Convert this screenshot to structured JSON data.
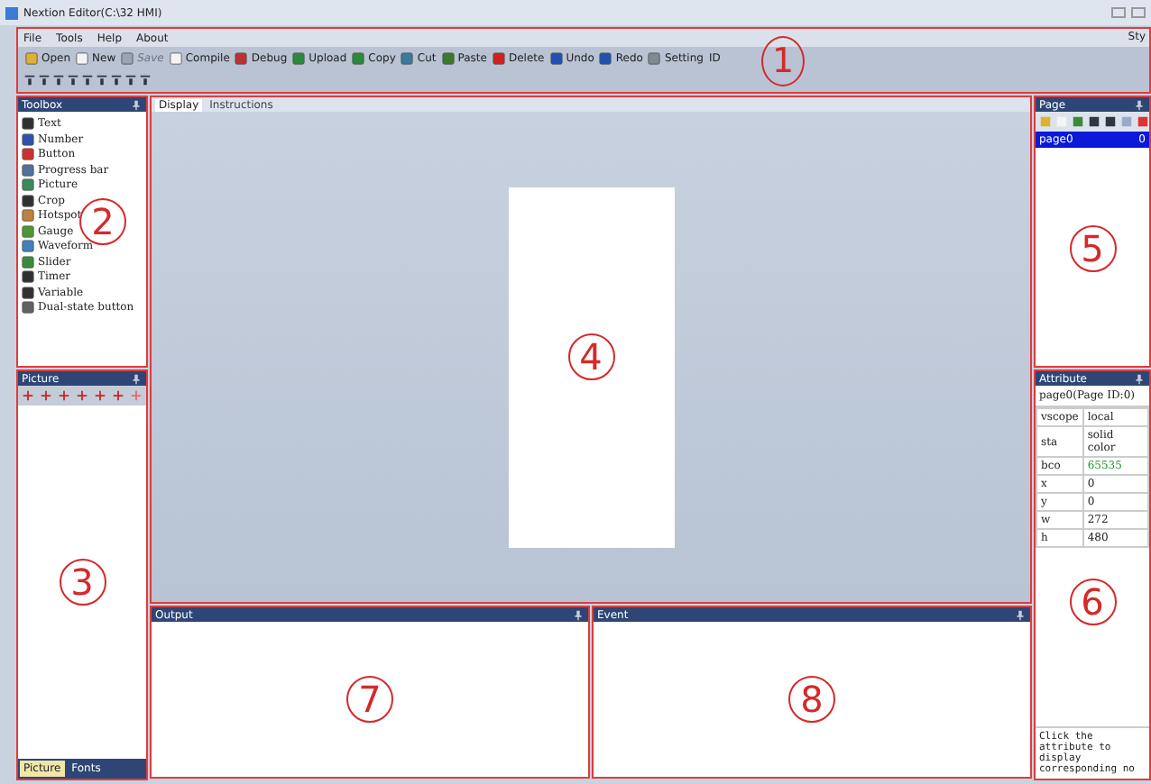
{
  "window": {
    "title": "Nextion Editor(C:\\32 HMI)",
    "right_text": "Sty"
  },
  "header": {
    "annotation": "1",
    "menu": [
      "File",
      "Tools",
      "Help",
      "About"
    ],
    "toolbar": [
      {
        "label": "Open",
        "disabled": false
      },
      {
        "label": "New",
        "disabled": false
      },
      {
        "label": "Save",
        "disabled": true
      },
      {
        "label": "Compile",
        "disabled": false
      },
      {
        "label": "Debug",
        "disabled": false
      },
      {
        "label": "Upload",
        "disabled": false
      },
      {
        "label": "Copy",
        "disabled": false
      },
      {
        "label": "Cut",
        "disabled": false
      },
      {
        "label": "Paste",
        "disabled": false
      },
      {
        "label": "Delete",
        "disabled": false
      },
      {
        "label": "Undo",
        "disabled": false
      },
      {
        "label": "Redo",
        "disabled": false
      },
      {
        "label": "Setting",
        "disabled": false
      },
      {
        "label": "ID",
        "disabled": false
      }
    ]
  },
  "toolbox": {
    "title": "Toolbox",
    "annotation": "2",
    "items": [
      "Text",
      "Number",
      "Button",
      "Progress bar",
      "Picture",
      "Crop",
      "Hotspot",
      "Gauge",
      "Waveform",
      "Slider",
      "Timer",
      "Variable",
      "Dual-state button"
    ]
  },
  "picture_panel": {
    "title": "Picture",
    "annotation": "3",
    "tabs": [
      {
        "label": "Picture",
        "selected": true
      },
      {
        "label": "Fonts",
        "selected": false
      }
    ]
  },
  "display": {
    "annotation": "4",
    "tabs": [
      {
        "label": "Display",
        "selected": true
      },
      {
        "label": "Instructions",
        "selected": false
      }
    ]
  },
  "output": {
    "title": "Output",
    "annotation": "7"
  },
  "event": {
    "title": "Event",
    "annotation": "8"
  },
  "page_panel": {
    "title": "Page",
    "annotation": "5",
    "pages": [
      {
        "name": "page0",
        "id": "0",
        "selected": true
      }
    ]
  },
  "attribute": {
    "title": "Attribute",
    "annotation": "6",
    "object": "page0(Page ID:0)",
    "rows": [
      {
        "name": "vscope",
        "value": "local",
        "kind": "plain"
      },
      {
        "name": "sta",
        "value": "solid color",
        "kind": "plain"
      },
      {
        "name": "bco",
        "value": "65535",
        "kind": "color"
      },
      {
        "name": "x",
        "value": "0",
        "kind": "plain"
      },
      {
        "name": "y",
        "value": "0",
        "kind": "plain"
      },
      {
        "name": "w",
        "value": "272",
        "kind": "plain"
      },
      {
        "name": "h",
        "value": "480",
        "kind": "plain"
      }
    ],
    "note": "Click the attribute to display corresponding no"
  }
}
